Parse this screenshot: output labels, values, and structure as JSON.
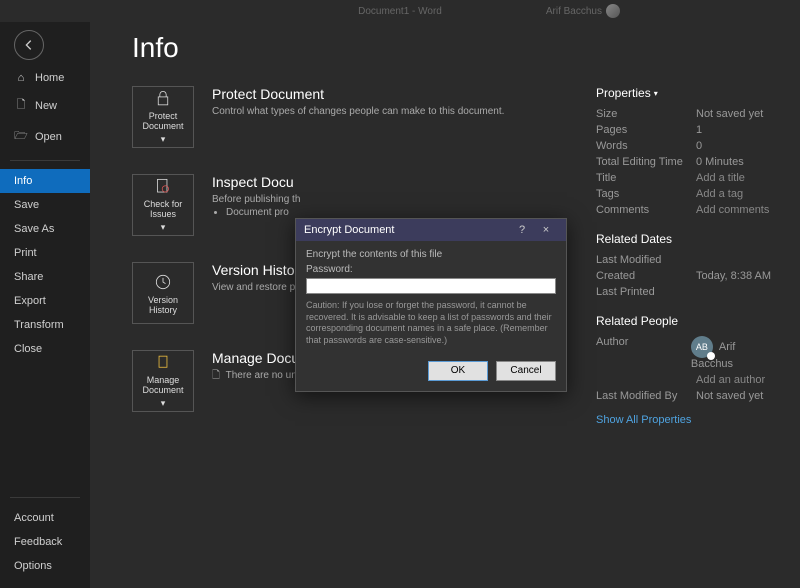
{
  "titlebar": {
    "doc": "Document1 - Word",
    "user": "Arif Bacchus"
  },
  "page_title": "Info",
  "nav": {
    "home": "Home",
    "new": "New",
    "open": "Open",
    "info": "Info",
    "save": "Save",
    "saveas": "Save As",
    "print": "Print",
    "share": "Share",
    "export": "Export",
    "transform": "Transform",
    "close": "Close",
    "account": "Account",
    "feedback": "Feedback",
    "options": "Options"
  },
  "cards": {
    "protect": {
      "tile": "Protect Document",
      "title": "Protect Document",
      "desc": "Control what types of changes people can make to this document."
    },
    "inspect": {
      "tile": "Check for Issues",
      "title": "Inspect Docu",
      "line1": "Before publishing th",
      "bullet": "Document pro"
    },
    "version": {
      "tile": "Version History",
      "title": "Version Histo",
      "desc": "View and restore pr"
    },
    "manage": {
      "tile": "Manage Document",
      "title": "Manage Document",
      "desc": "There are no unsaved changes."
    }
  },
  "props": {
    "hdr_properties": "Properties",
    "size": {
      "l": "Size",
      "v": "Not saved yet"
    },
    "pages": {
      "l": "Pages",
      "v": "1"
    },
    "words": {
      "l": "Words",
      "v": "0"
    },
    "editing": {
      "l": "Total Editing Time",
      "v": "0 Minutes"
    },
    "title": {
      "l": "Title",
      "v": "Add a title"
    },
    "tags": {
      "l": "Tags",
      "v": "Add a tag"
    },
    "comments": {
      "l": "Comments",
      "v": "Add comments"
    },
    "hdr_dates": "Related Dates",
    "modified": {
      "l": "Last Modified",
      "v": ""
    },
    "created": {
      "l": "Created",
      "v": "Today, 8:38 AM"
    },
    "printed": {
      "l": "Last Printed",
      "v": ""
    },
    "hdr_people": "Related People",
    "author": {
      "l": "Author",
      "initials": "AB",
      "name": "Arif Bacchus",
      "add": "Add an author"
    },
    "lastmodby": {
      "l": "Last Modified By",
      "v": "Not saved yet"
    },
    "showall": "Show All Properties"
  },
  "dialog": {
    "title": "Encrypt Document",
    "instr": "Encrypt the contents of this file",
    "pw_label": "Password:",
    "pw_value": "",
    "caution": "Caution: If you lose or forget the password, it cannot be recovered. It is advisable to keep a list of passwords and their corresponding document names in a safe place. (Remember that passwords are case-sensitive.)",
    "ok": "OK",
    "cancel": "Cancel",
    "help": "?",
    "close": "×"
  }
}
